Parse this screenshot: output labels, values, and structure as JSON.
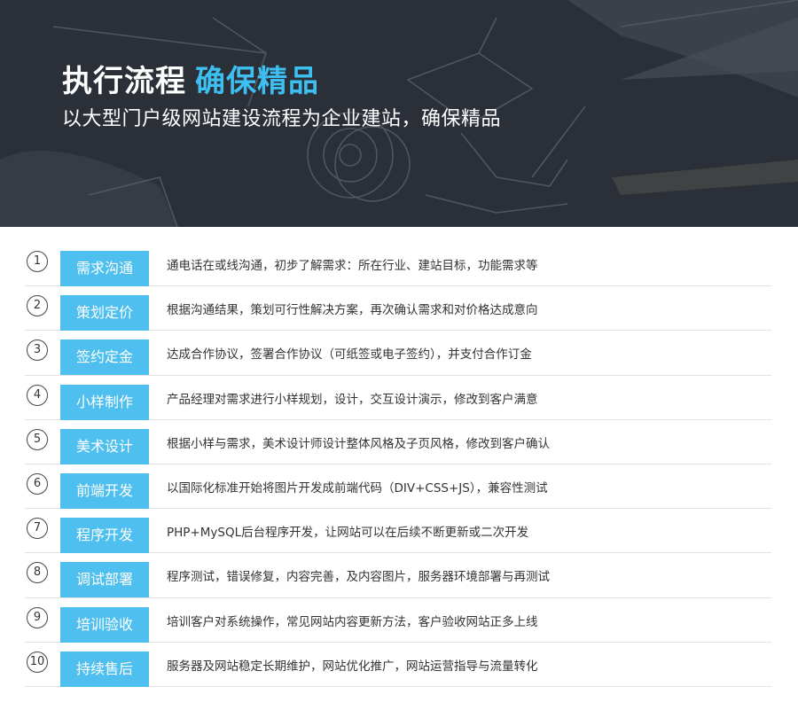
{
  "header": {
    "title": "执行流程",
    "title_accent": "确保精品",
    "subtitle": "以大型门户级网站建设流程为企业建站，确保精品"
  },
  "colors": {
    "accent": "#3dc0f1",
    "label_bg": "#4ebfee",
    "hero_bg": "#2c3038"
  },
  "steps": [
    {
      "number": "1",
      "label": "需求沟通",
      "description": "通电话在或线沟通，初步了解需求：所在行业、建站目标，功能需求等"
    },
    {
      "number": "2",
      "label": "策划定价",
      "description": "根据沟通结果，策划可行性解决方案，再次确认需求和对价格达成意向"
    },
    {
      "number": "3",
      "label": "签约定金",
      "description": "达成合作协议，签署合作协议（可纸签或电子签约），并支付合作订金"
    },
    {
      "number": "4",
      "label": "小样制作",
      "description": "产品经理对需求进行小样规划，设计，交互设计演示，修改到客户满意"
    },
    {
      "number": "5",
      "label": "美术设计",
      "description": "根据小样与需求，美术设计师设计整体风格及子页风格，修改到客户确认"
    },
    {
      "number": "6",
      "label": "前端开发",
      "description": "以国际化标准开始将图片开发成前端代码（DIV+CSS+JS），兼容性测试"
    },
    {
      "number": "7",
      "label": "程序开发",
      "description": "PHP+MySQL后台程序开发，让网站可以在后续不断更新或二次开发"
    },
    {
      "number": "8",
      "label": "调试部署",
      "description": "程序测试，错误修复，内容完善，及内容图片，服务器环境部署与再测试"
    },
    {
      "number": "9",
      "label": "培训验收",
      "description": "培训客户对系统操作，常见网站内容更新方法，客户验收网站正多上线"
    },
    {
      "number": "10",
      "label": "持续售后",
      "description": "服务器及网站稳定长期维护，网站优化推广，网站运营指导与流量转化"
    }
  ]
}
